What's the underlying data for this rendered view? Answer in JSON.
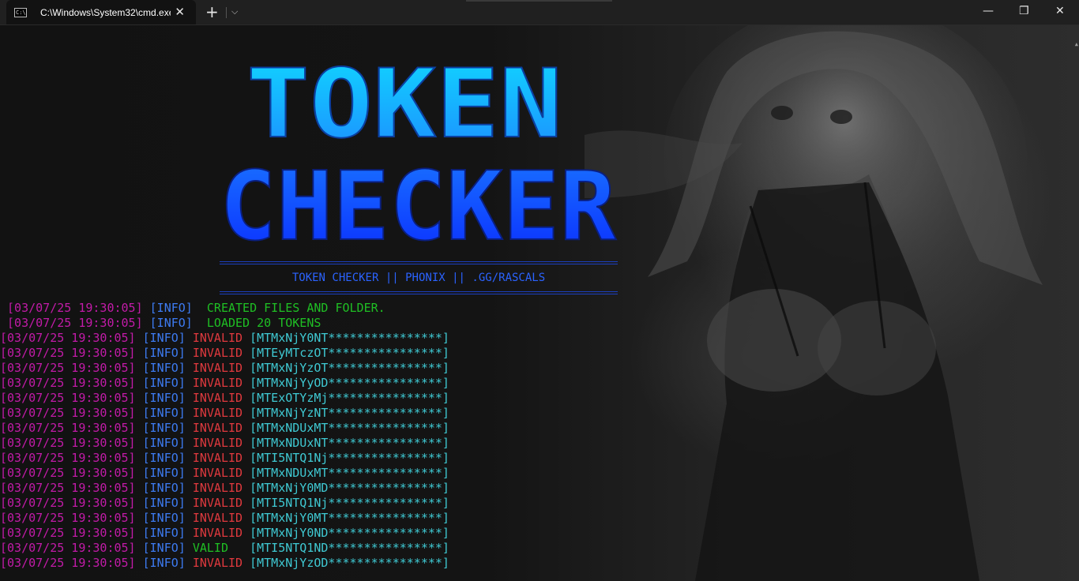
{
  "window": {
    "tab_title": "C:\\Windows\\System32\\cmd.exe",
    "icon_text": "C:\\",
    "close_glyph": "✕",
    "new_tab_glyph": "+",
    "dropdown_glyph": "⌵",
    "minimize_glyph": "—",
    "maximize_glyph": "❐",
    "window_close_glyph": "✕"
  },
  "banner": {
    "line1": "TOKEN",
    "line2": "CHECKER",
    "credits": "TOKEN CHECKER || PHONIX || .GG/RASCALS",
    "gradient_top": "#10d7ff",
    "gradient_bottom": "#0a2dff"
  },
  "colors": {
    "timestamp": "#c21ba8",
    "info": "#3d7bf2",
    "green": "#1fbf24",
    "red": "#e0393e",
    "token": "#3fc9d3"
  },
  "log": {
    "setup": [
      {
        "time": "[03/07/25 19:30:05]",
        "level": "[INFO]",
        "message": "CREATED FILES AND FOLDER."
      },
      {
        "time": "[03/07/25 19:30:05]",
        "level": "[INFO]",
        "message": "LOADED 20 TOKENS"
      }
    ],
    "checks": [
      {
        "time": "[03/07/25 19:30:05]",
        "level": "[INFO]",
        "status": "INVALID",
        "token": "[MTMxNjY0NT****************]"
      },
      {
        "time": "[03/07/25 19:30:05]",
        "level": "[INFO]",
        "status": "INVALID",
        "token": "[MTEyMTczOT****************]"
      },
      {
        "time": "[03/07/25 19:30:05]",
        "level": "[INFO]",
        "status": "INVALID",
        "token": "[MTMxNjYzOT****************]"
      },
      {
        "time": "[03/07/25 19:30:05]",
        "level": "[INFO]",
        "status": "INVALID",
        "token": "[MTMxNjYyOD****************]"
      },
      {
        "time": "[03/07/25 19:30:05]",
        "level": "[INFO]",
        "status": "INVALID",
        "token": "[MTExOTYzMj****************]"
      },
      {
        "time": "[03/07/25 19:30:05]",
        "level": "[INFO]",
        "status": "INVALID",
        "token": "[MTMxNjYzNT****************]"
      },
      {
        "time": "[03/07/25 19:30:05]",
        "level": "[INFO]",
        "status": "INVALID",
        "token": "[MTMxNDUxMT****************]"
      },
      {
        "time": "[03/07/25 19:30:05]",
        "level": "[INFO]",
        "status": "INVALID",
        "token": "[MTMxNDUxNT****************]"
      },
      {
        "time": "[03/07/25 19:30:05]",
        "level": "[INFO]",
        "status": "INVALID",
        "token": "[MTI5NTQ1Nj****************]"
      },
      {
        "time": "[03/07/25 19:30:05]",
        "level": "[INFO]",
        "status": "INVALID",
        "token": "[MTMxNDUxMT****************]"
      },
      {
        "time": "[03/07/25 19:30:05]",
        "level": "[INFO]",
        "status": "INVALID",
        "token": "[MTMxNjY0MD****************]"
      },
      {
        "time": "[03/07/25 19:30:05]",
        "level": "[INFO]",
        "status": "INVALID",
        "token": "[MTI5NTQ1Nj****************]"
      },
      {
        "time": "[03/07/25 19:30:05]",
        "level": "[INFO]",
        "status": "INVALID",
        "token": "[MTMxNjY0MT****************]"
      },
      {
        "time": "[03/07/25 19:30:05]",
        "level": "[INFO]",
        "status": "INVALID",
        "token": "[MTMxNjY0ND****************]"
      },
      {
        "time": "[03/07/25 19:30:05]",
        "level": "[INFO]",
        "status": "VALID",
        "token": "[MTI5NTQ1ND****************]"
      },
      {
        "time": "[03/07/25 19:30:05]",
        "level": "[INFO]",
        "status": "INVALID",
        "token": "[MTMxNjYzOD****************]"
      }
    ]
  }
}
